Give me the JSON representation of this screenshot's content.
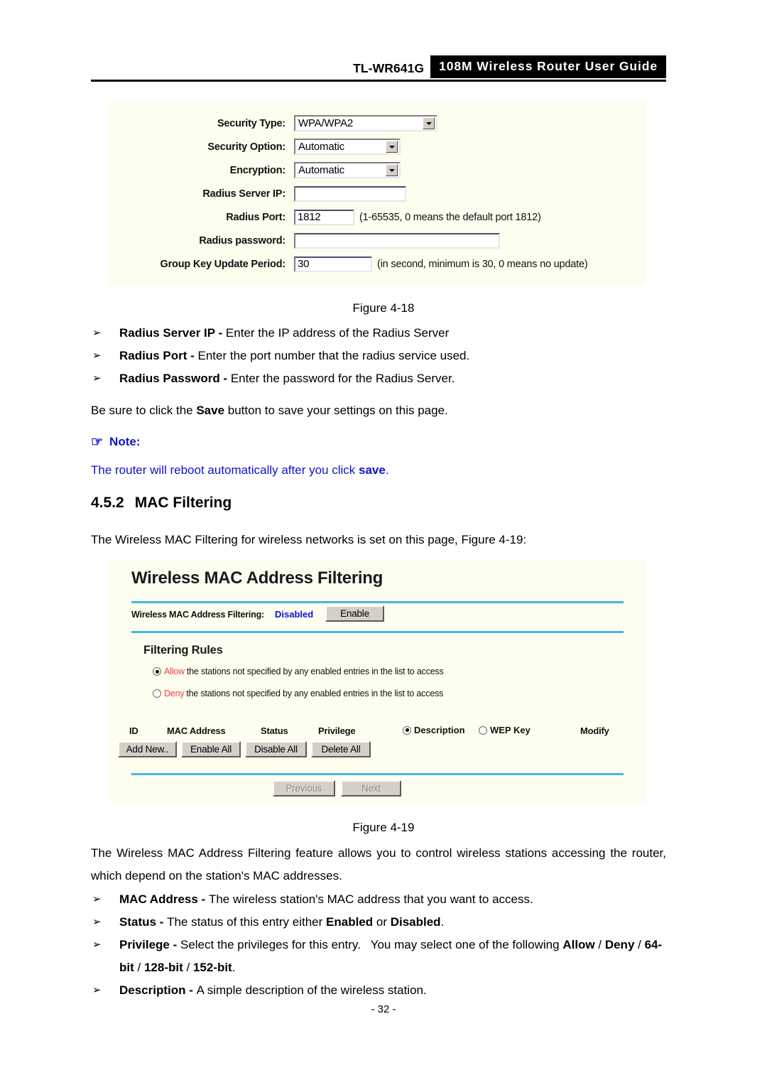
{
  "header": {
    "model": "TL-WR641G",
    "title": "108M Wireless Router User Guide"
  },
  "security_form": {
    "rows": [
      {
        "label": "Security Type:",
        "value": "WPA/WPA2",
        "hint": ""
      },
      {
        "label": "Security Option:",
        "value": "Automatic",
        "hint": ""
      },
      {
        "label": "Encryption:",
        "value": "Automatic",
        "hint": ""
      },
      {
        "label": "Radius Server IP:",
        "value": "",
        "hint": ""
      },
      {
        "label": "Radius Port:",
        "value": "1812",
        "hint": "(1-65535, 0 means the default port 1812)"
      },
      {
        "label": "Radius password:",
        "value": "",
        "hint": ""
      },
      {
        "label": "Group Key Update Period:",
        "value": "30",
        "hint": "(in second, minimum is 30, 0 means no update)"
      }
    ]
  },
  "figure_18_caption": "Figure 4-18",
  "bullets_top": [
    {
      "arrow": "➢",
      "term": "Radius Server IP - ",
      "text": "Enter the IP address of the Radius Server"
    },
    {
      "arrow": "➢",
      "term": "Radius Port - ",
      "text": "Enter the port number that the radius service used."
    },
    {
      "arrow": "➢",
      "term": "Radius Password - ",
      "text": "Enter the password for the Radius Server."
    }
  ],
  "save_note": {
    "pre": "Be sure to click the ",
    "bold": "Save",
    "post": " button to save your settings on this page."
  },
  "note": {
    "icon": "☞",
    "label": "Note:",
    "body_pre": "The router will reboot automatically after you click ",
    "body_bold": "save",
    "body_post": "."
  },
  "section": {
    "number": "4.5.2",
    "title": "MAC Filtering"
  },
  "intro": "The Wireless MAC Filtering for wireless networks is set on this page, Figure 4-19:",
  "mac_panel": {
    "title": "Wireless MAC Address Filtering",
    "filtering_label": "Wireless MAC Address Filtering:",
    "filtering_status": "Disabled",
    "enable_button": "Enable",
    "rules_heading": "Filtering Rules",
    "rules": [
      {
        "keyword": "Allow",
        "text": "the stations not specified by any enabled entries in the list to access",
        "selected": true
      },
      {
        "keyword": "Deny",
        "text": "the stations not specified by any enabled entries in the list to access",
        "selected": false
      }
    ],
    "table_headers": [
      "ID",
      "MAC Address",
      "Status",
      "Privilege",
      "Modify"
    ],
    "table_radio_headers": [
      {
        "label": "Description",
        "selected": true
      },
      {
        "label": "WEP Key",
        "selected": false
      }
    ],
    "action_buttons": [
      "Add New..",
      "Enable All",
      "Disable All",
      "Delete All"
    ],
    "pager_buttons": [
      {
        "label": "Previous",
        "disabled": true
      },
      {
        "label": "Next",
        "disabled": true
      }
    ]
  },
  "figure_19_caption": "Figure 4-19",
  "body_paragraph": "The Wireless MAC Address Filtering feature allows you to control wireless stations accessing the router, which depend on the station's MAC addresses.",
  "bullets_bottom": [
    {
      "arrow": "➢",
      "term": "MAC Address - ",
      "text": "The wireless station's MAC address that you want to access."
    },
    {
      "arrow": "➢",
      "term": "Status - ",
      "text": "The status of this entry either Enabled or Disabled."
    },
    {
      "arrow": "➢",
      "term": "Privilege - ",
      "text": "Select the privileges for this entry.   You may select one of the following Allow / Deny / 64-bit / 128-bit / 152-bit."
    },
    {
      "arrow": "➢",
      "term": "Description - ",
      "text": "A simple description of the wireless station."
    }
  ],
  "page_number": "- 32 -",
  "colors": {
    "panel_bg": "#FDFDF0",
    "divider": "#45B6E8",
    "note_blue": "#1111CC",
    "rule_red": "#F4413C",
    "button_face": "#D4D0C8"
  }
}
